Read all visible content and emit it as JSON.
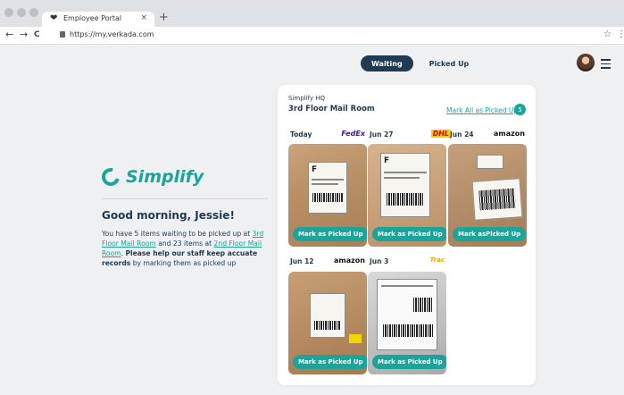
{
  "browser": {
    "tab_title": "Employee Portal",
    "tab_close": "×",
    "new_tab": "+",
    "url": "https://my.verkada.com",
    "icons": {
      "back": "←",
      "forward": "→",
      "reload": "C",
      "star": "☆",
      "menu": "⋮",
      "favicon": "❤"
    }
  },
  "header": {
    "tabs": [
      {
        "label": "Waiting",
        "active": true
      },
      {
        "label": "Picked Up",
        "active": false
      }
    ]
  },
  "greeting": {
    "brand": "Simplify",
    "title": "Good morning, Jessie!",
    "msg_1": "You have 5 items waiting to be picked up at ",
    "link_1": "3rd Floor Mail Room",
    "msg_2": " and 23 items at ",
    "link_2": "2nd Floor Mail Room",
    "msg_3": ". ",
    "bold_1": "Please help our staff keep accuate records",
    "msg_4": " by marking them as picked up"
  },
  "mailroom": {
    "org": "Simplify HQ",
    "location": "3rd Floor Mail Room",
    "mark_all": "Mark All as Picked Up",
    "count": "5",
    "packages": [
      {
        "date": "Today",
        "carrier": "FedEx",
        "carrier_color": "#4d148c",
        "button": "Mark as Picked Up",
        "label_text": "F"
      },
      {
        "date": "Jun 27",
        "carrier": "DHL",
        "carrier_color": "#d40511",
        "button": "Mark as Picked Up",
        "label_text": "F"
      },
      {
        "date": "Jun 24",
        "carrier": "amazon",
        "carrier_color": "#111111",
        "button": "Mark asPicked Up",
        "label_text": ""
      },
      {
        "date": "Jun 12",
        "carrier": "amazon",
        "carrier_color": "#111111",
        "button": "Mark as Picked Up",
        "label_text": ""
      },
      {
        "date": "Jun 3",
        "carrier": "Trac",
        "carrier_color": "#f2a900",
        "button": "Mark as Picked Up",
        "label_text": ""
      }
    ]
  },
  "colors": {
    "accent": "#1aa49a",
    "navy": "#1f3a52",
    "page_bg": "#eef0f1"
  }
}
